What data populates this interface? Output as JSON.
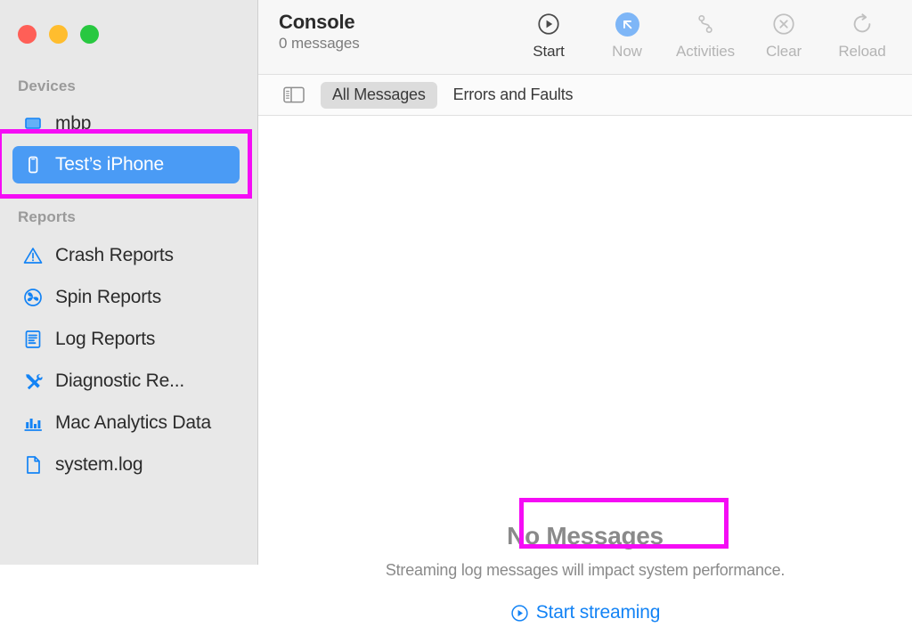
{
  "window": {
    "traffic_lights": [
      {
        "name": "close",
        "color": "#ff5f57"
      },
      {
        "name": "minimize",
        "color": "#ffbd2e"
      },
      {
        "name": "zoom",
        "color": "#28c840"
      }
    ]
  },
  "sidebar": {
    "sections": [
      {
        "header": "Devices",
        "items": [
          {
            "label": "mbp",
            "icon": "mac-icon",
            "selected": false
          },
          {
            "label": "Test’s iPhone",
            "icon": "iphone-icon",
            "selected": true
          }
        ]
      },
      {
        "header": "Reports",
        "items": [
          {
            "label": "Crash Reports",
            "icon": "warning-triangle-icon",
            "selected": false
          },
          {
            "label": "Spin Reports",
            "icon": "spinner-icon",
            "selected": false
          },
          {
            "label": "Log Reports",
            "icon": "document-lines-icon",
            "selected": false
          },
          {
            "label": "Diagnostic Re...",
            "icon": "tools-icon",
            "selected": false
          },
          {
            "label": "Mac Analytics Data",
            "icon": "bar-chart-icon",
            "selected": false
          },
          {
            "label": "system.log",
            "icon": "file-icon",
            "selected": false
          }
        ]
      }
    ]
  },
  "toolbar": {
    "title": "Console",
    "subtitle": "0 messages",
    "buttons": [
      {
        "label": "Start",
        "icon": "play-circle-icon",
        "state": "enabled"
      },
      {
        "label": "Now",
        "icon": "arrow-up-left-icon",
        "state": "active"
      },
      {
        "label": "Activities",
        "icon": "activities-icon",
        "state": "disabled"
      },
      {
        "label": "Clear",
        "icon": "clear-circle-x-icon",
        "state": "disabled"
      },
      {
        "label": "Reload",
        "icon": "reload-icon",
        "state": "disabled"
      }
    ]
  },
  "filterbar": {
    "sidebar_toggle_icon": "sidebar-toggle-icon",
    "segments": [
      {
        "label": "All Messages",
        "selected": true
      },
      {
        "label": "Errors and Faults",
        "selected": false
      }
    ]
  },
  "content": {
    "empty_title": "No Messages",
    "empty_subtitle": "Streaming log messages will impact system performance.",
    "start_streaming_label": "Start streaming",
    "start_streaming_icon": "play-circle-icon"
  },
  "annotations": {
    "highlight_color": "#f50cf5",
    "boxes": [
      {
        "name": "device-highlight",
        "target": "Test’s iPhone"
      },
      {
        "name": "start-streaming-highlight",
        "target": "Start streaming"
      }
    ]
  }
}
